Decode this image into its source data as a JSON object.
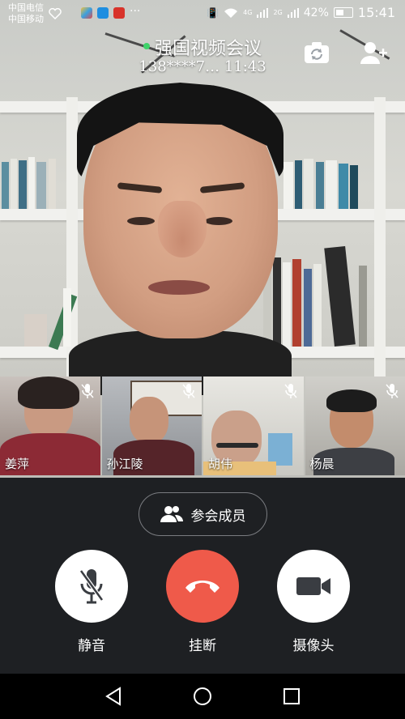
{
  "status_bar": {
    "carrier_1": "中国电信",
    "carrier_2": "中国移动",
    "network_4g": "4G",
    "network_2g": "2G",
    "battery": "42%",
    "time": "15:41"
  },
  "call": {
    "title": "强国视频会议",
    "subtitle": "138****7…  11:43"
  },
  "top_actions": {
    "switch_camera_icon": "camera-switch-icon",
    "add_member_icon": "add-person-icon"
  },
  "participants": [
    {
      "name": "姜萍",
      "muted": true
    },
    {
      "name": "孙江陵",
      "muted": true
    },
    {
      "name": "胡伟",
      "muted": true
    },
    {
      "name": "杨晨",
      "muted": true
    }
  ],
  "members_button": {
    "label": "参会成员"
  },
  "controls": {
    "mute": {
      "label": "静音"
    },
    "hangup": {
      "label": "挂断"
    },
    "camera": {
      "label": "摄像头"
    }
  },
  "colors": {
    "hangup": "#ef5a4a",
    "control_bg": "#ffffff",
    "panel_bg": "#1e2023",
    "online_dot": "#3ed36a"
  }
}
